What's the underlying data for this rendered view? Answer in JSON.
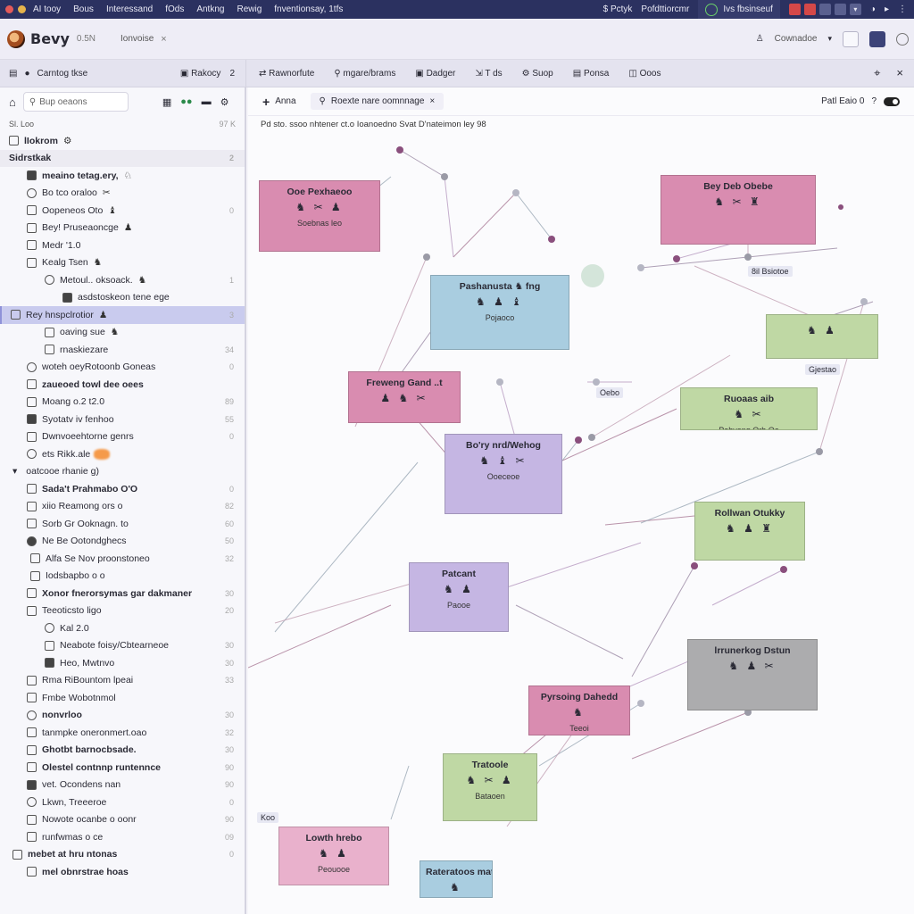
{
  "colors": {
    "os_bar": "#2b3160",
    "accent": "#8f92d8",
    "node_pink": "#d98cb0",
    "node_blue": "#a9cde0",
    "node_purple": "#c5b6e3",
    "node_green": "#bfd8a4",
    "node_gray": "#acacae"
  },
  "os": {
    "menu": [
      "AI tooy",
      "Bous",
      "Interessand",
      "fOds",
      "Antkng",
      "Rewig",
      "fnventionsay, 1tfs"
    ],
    "status": "$ Pctyk",
    "status2": "Pofdttiorcmr",
    "seg": "Ivs fbsinseuf"
  },
  "app": {
    "name": "Bevy",
    "version": "0.5N",
    "tab": "Ionvoise",
    "search_label": "Cownadoe",
    "close": "×"
  },
  "subbar": {
    "left": "Carntog tkse",
    "left_r1": "Rakocy",
    "left_r2": "2",
    "items": [
      "Rawnorfute",
      "mgare/brams",
      "Dadger",
      "T ds",
      "Suop",
      "Ponsa",
      "Ooos"
    ]
  },
  "sidebar": {
    "search_placeholder": "Bup oeaons",
    "tree_title": "Sl. Loo",
    "tree_count": "97 K",
    "rows": [
      {
        "label": "lIokrom",
        "glyph": "⚙",
        "n": "",
        "kind": "hdr"
      },
      {
        "label": "Sidrstkak",
        "glyph": "",
        "n": "2",
        "kind": "sec"
      },
      {
        "label": "meaino tetag.ery,",
        "glyph": "♘",
        "n": "",
        "kind": "bold"
      },
      {
        "label": "Bo tco oraloo",
        "glyph": "✂",
        "n": "",
        "kind": ""
      },
      {
        "label": "Oopeneos Oto",
        "glyph": "♝",
        "n": "0",
        "kind": ""
      },
      {
        "label": "Bey! Pruseaoncge",
        "glyph": "♟",
        "n": "",
        "kind": ""
      },
      {
        "label": "Medr '1.0",
        "glyph": "",
        "n": "",
        "kind": ""
      },
      {
        "label": "Kealg Tsen",
        "glyph": "♞",
        "n": "",
        "kind": ""
      },
      {
        "label": "Metoul.. oksoack.",
        "glyph": "♞",
        "n": "1",
        "kind": ""
      },
      {
        "label": "asdstoskeon tene ege",
        "glyph": "",
        "n": "",
        "kind": ""
      },
      {
        "label": "Rey hnspclrotior",
        "glyph": "♟",
        "n": "3",
        "kind": "sel"
      },
      {
        "label": "oaving sue",
        "glyph": "♞",
        "n": "",
        "kind": ""
      },
      {
        "label": "rnaskiezare",
        "glyph": "",
        "n": "34",
        "kind": ""
      },
      {
        "label": "woteh oeyRotoonb Goneas",
        "glyph": "",
        "n": "0",
        "kind": ""
      },
      {
        "label": "zaueoed towl dee oees",
        "glyph": "",
        "n": "",
        "kind": "bold"
      },
      {
        "label": "Moang o.2 t2.0",
        "glyph": "",
        "n": "89",
        "kind": ""
      },
      {
        "label": "Syotatv iv fenhoo",
        "glyph": "",
        "n": "55",
        "kind": ""
      },
      {
        "label": "Dwnvoeehtorne genrs",
        "glyph": "",
        "n": "0",
        "kind": ""
      },
      {
        "label": "ets Rikk.ale",
        "glyph": "",
        "n": "",
        "kind": "orange"
      },
      {
        "label": "oatcooe rhanie g)",
        "glyph": "",
        "n": "",
        "kind": "sec2"
      },
      {
        "label": "Sada't Prahmabo O'O",
        "glyph": "",
        "n": "0",
        "kind": "bold"
      },
      {
        "label": "xiio Reamong ors o",
        "glyph": "",
        "n": "82",
        "kind": ""
      },
      {
        "label": "Sorb Gr Ooknagn. to",
        "glyph": "",
        "n": "60",
        "kind": ""
      },
      {
        "label": "Ne Be Ootondghecs",
        "glyph": "",
        "n": "50",
        "kind": ""
      },
      {
        "label": "Alfa Se Nov proonstoneo",
        "glyph": "",
        "n": "32",
        "kind": ""
      },
      {
        "label": "Iodsbapbo o o",
        "glyph": "",
        "n": "",
        "kind": ""
      },
      {
        "label": "Xonor fnerorsymas gar dakmaner",
        "glyph": "",
        "n": "30",
        "kind": "bold"
      },
      {
        "label": "Teeoticsto ligo",
        "glyph": "",
        "n": "20",
        "kind": ""
      },
      {
        "label": "Kal 2.0",
        "glyph": "",
        "n": "",
        "kind": ""
      },
      {
        "label": "Neabote foisy/Cbtearneoe",
        "glyph": "",
        "n": "30",
        "kind": ""
      },
      {
        "label": "Heo, Mwtnvo",
        "glyph": "",
        "n": "30",
        "kind": ""
      },
      {
        "label": "Rma RiBountom lpeai",
        "glyph": "",
        "n": "33",
        "kind": ""
      },
      {
        "label": "Fmbe Wobotnmol",
        "glyph": "",
        "n": "",
        "kind": ""
      },
      {
        "label": "nonvrloo",
        "glyph": "",
        "n": "30",
        "kind": "bold"
      },
      {
        "label": "tanmpke oneronmert.oao",
        "glyph": "",
        "n": "32",
        "kind": ""
      },
      {
        "label": "Ghotbt barnocbsade.",
        "glyph": "",
        "n": "30",
        "kind": "bold"
      },
      {
        "label": "Olestel contnnp runtennce",
        "glyph": "",
        "n": "90",
        "kind": "bold"
      },
      {
        "label": "vet. Ocondens nan",
        "glyph": "",
        "n": "90",
        "kind": ""
      },
      {
        "label": "Lkwn, Treeeroe",
        "glyph": "",
        "n": "0",
        "kind": ""
      },
      {
        "label": "Nowote ocanbe o oonr",
        "glyph": "",
        "n": "90",
        "kind": ""
      },
      {
        "label": "runfwmas o ce",
        "glyph": "",
        "n": "09",
        "kind": ""
      },
      {
        "label": "mebet at hru ntonas",
        "glyph": "",
        "n": "0",
        "kind": "bold"
      },
      {
        "label": "mel obnrstrae hoas",
        "glyph": "",
        "n": "",
        "kind": "bold"
      }
    ]
  },
  "canvas": {
    "add_label": "Anna",
    "tab_label": "Roexte nare oomnnage",
    "toggle_label": "Patl Eaio 0",
    "crumb": "Pd sto. ssoo nhtener ct.o  Ioanoedno Svat D'nateimon ley 98",
    "nodes": [
      {
        "title": "Ooe Pexhaeoo",
        "sub": "Soebnas leo",
        "glyph": "♞ ✂ ♟"
      },
      {
        "title": "Bey Deb Obebe",
        "sub": "",
        "glyph": "♞ ✂ ♜"
      },
      {
        "title": "Pashanusta ♞ fng",
        "sub": "Pojaoco",
        "glyph": "♞ ♟ ♝"
      },
      {
        "title": "Freweng Gand ..t",
        "sub": "",
        "glyph": "♟ ♞ ✂"
      },
      {
        "title": "Bo'ry nrd/Wehog",
        "sub": "Ooeceoe",
        "glyph": "♞ ♝ ✂"
      },
      {
        "title": "Patcant",
        "sub": "Paooe",
        "glyph": "♞ ♟"
      },
      {
        "title": "Ruoaas aib",
        "sub": "Pahvang Orb Oo",
        "glyph": "♞ ✂"
      },
      {
        "title": "Rollwan Otukky",
        "sub": "",
        "glyph": "♞ ♟ ♜"
      },
      {
        "title": "lrrunerkog Dstun",
        "sub": "",
        "glyph": "♞ ♟ ✂"
      },
      {
        "title": "Pyrsoing Dahedd",
        "sub": "Teeoi",
        "glyph": "♞"
      },
      {
        "title": "Tratoole",
        "sub": "Bataoen",
        "glyph": "♞ ✂ ♟"
      },
      {
        "title": "Lowth hrebo",
        "sub": "Peouooe",
        "glyph": "♞ ♟"
      },
      {
        "title": "Rateratoos mat",
        "sub": "",
        "glyph": "♞"
      },
      {
        "title": "",
        "sub": "",
        "glyph": "♞ ♟"
      }
    ],
    "chips": [
      "8il Bsiotoe",
      "Gjestao",
      "Oebo",
      "Koo"
    ]
  }
}
